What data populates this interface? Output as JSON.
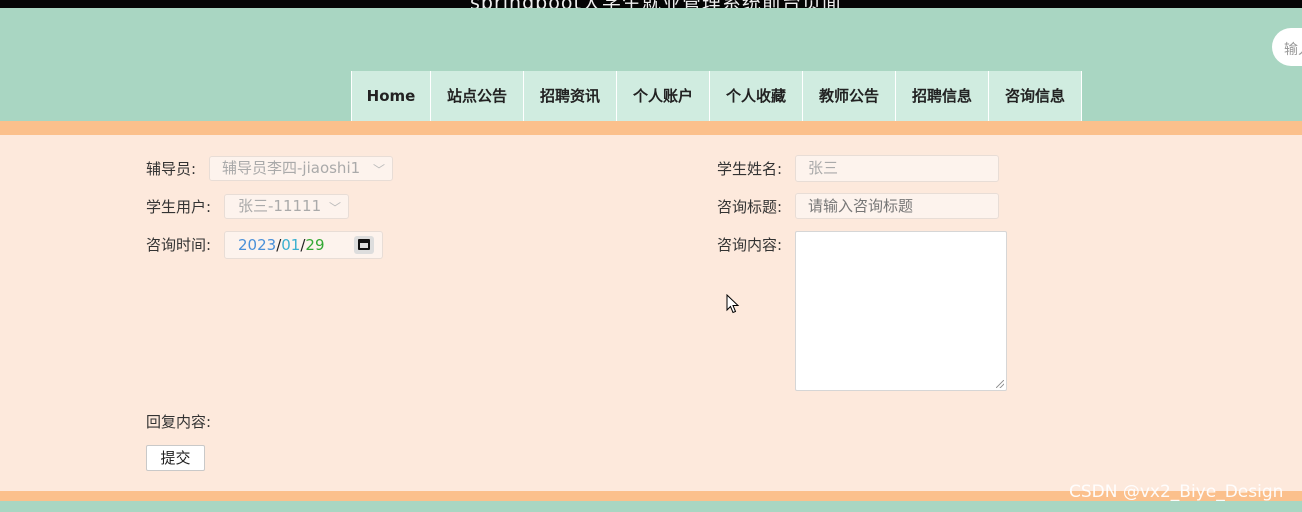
{
  "window": {
    "title": "springboot大学生就业管理系统前台页面"
  },
  "search": {
    "placeholder": "输入关键字"
  },
  "nav": {
    "items": [
      {
        "label": "Home"
      },
      {
        "label": "站点公告"
      },
      {
        "label": "招聘资讯"
      },
      {
        "label": "个人账户"
      },
      {
        "label": "个人收藏"
      },
      {
        "label": "教师公告"
      },
      {
        "label": "招聘信息"
      },
      {
        "label": "咨询信息"
      }
    ]
  },
  "form": {
    "counselor": {
      "label": "辅导员:",
      "value": "辅导员李四-jiaoshi1"
    },
    "student_user": {
      "label": "学生用户:",
      "value": "张三-11111"
    },
    "consult_time": {
      "label": "咨询时间:",
      "year": "2023",
      "month": "01",
      "day": "29"
    },
    "student_name": {
      "label": "学生姓名:",
      "value": "张三"
    },
    "consult_title": {
      "label": "咨询标题:",
      "placeholder": "请输入咨询标题"
    },
    "consult_content": {
      "label": "咨询内容:",
      "value": ""
    },
    "reply_content": {
      "label": "回复内容:"
    },
    "submit_label": "提交"
  },
  "watermark": "CSDN @vx2_Biye_Design",
  "colors": {
    "header_bg": "#a9d6c2",
    "band_orange": "#fbc08c",
    "content_bg": "#fde9dc",
    "nav_item_bg": "#d0ece0"
  }
}
